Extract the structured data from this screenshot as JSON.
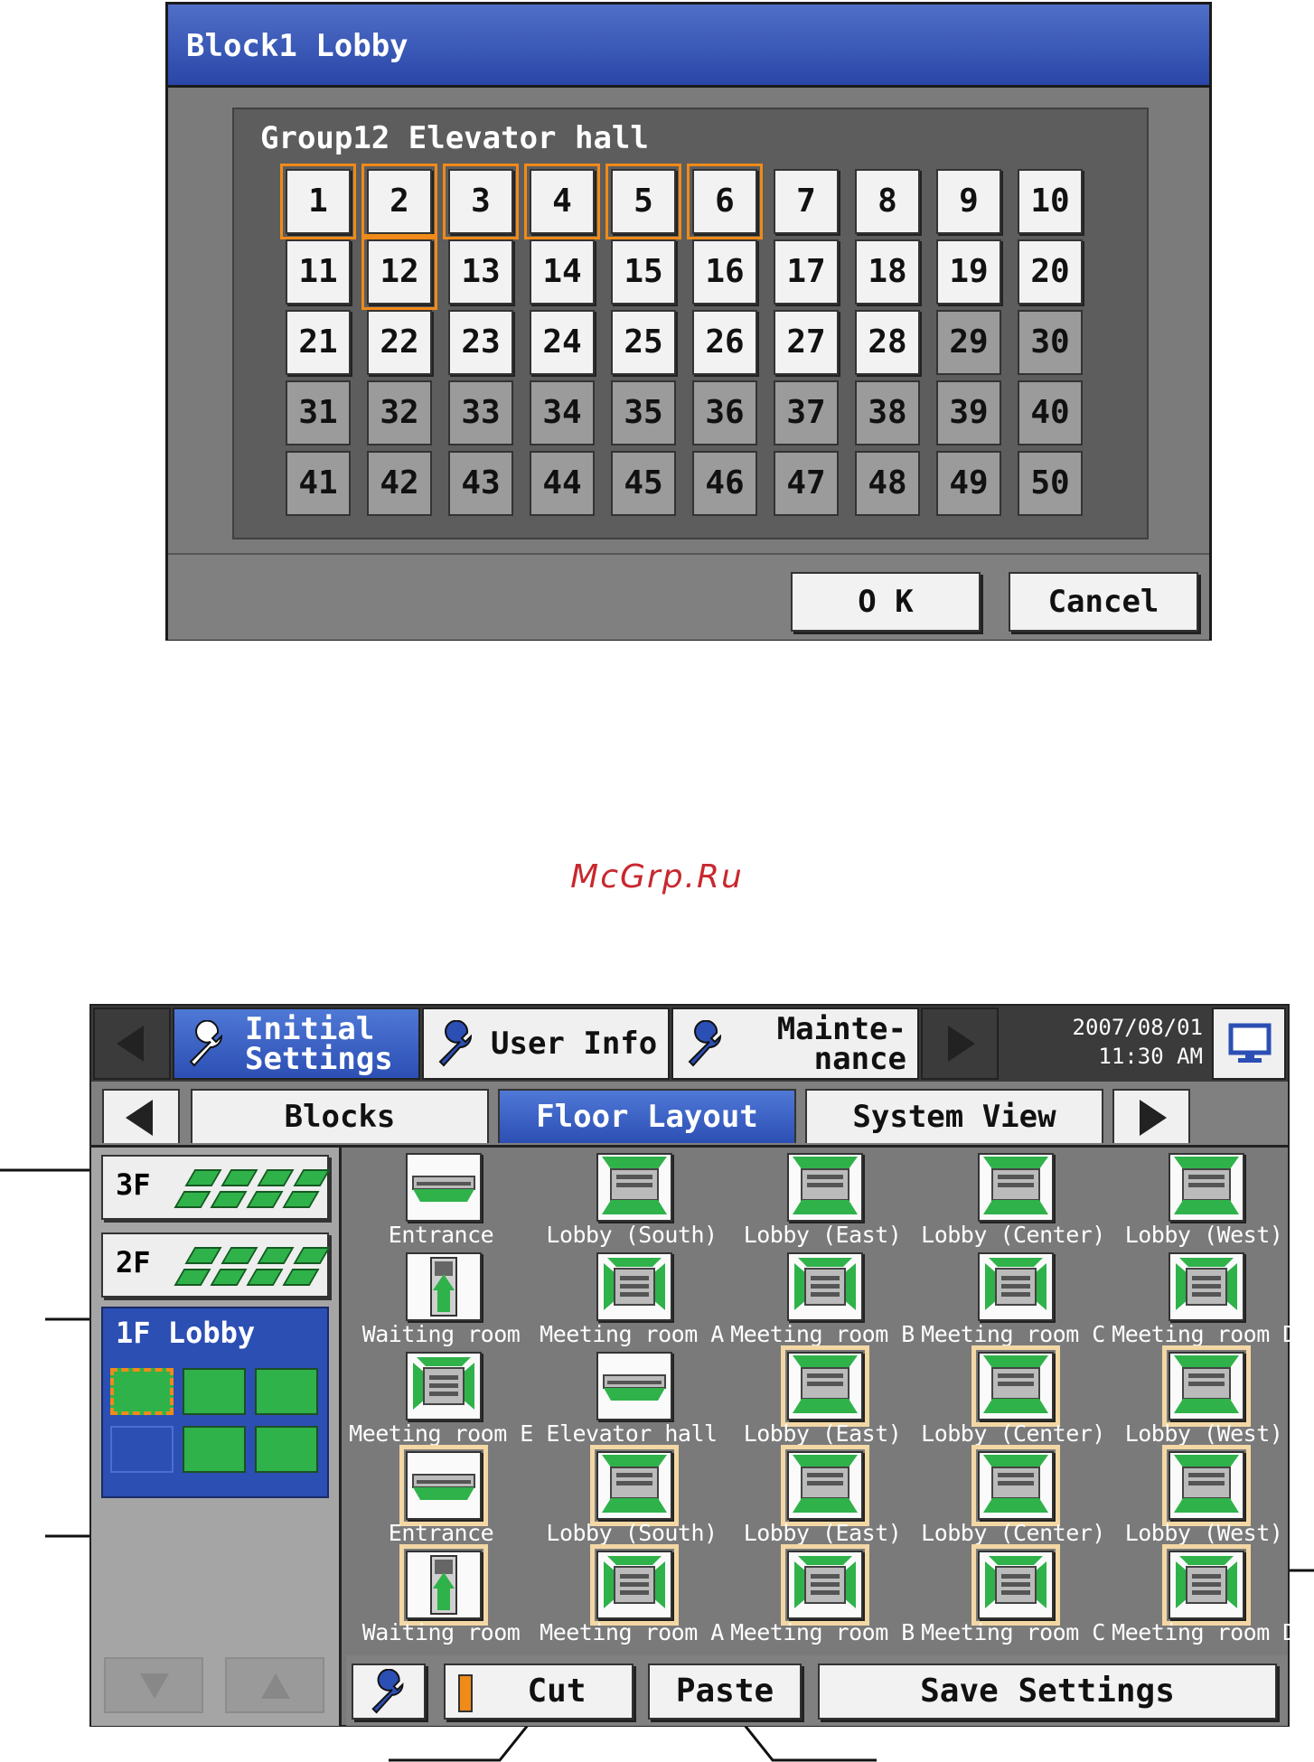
{
  "dialog": {
    "title": "Block1 Lobby",
    "group_label": "Group12 Elevator hall",
    "numbers": [
      "1",
      "2",
      "3",
      "4",
      "5",
      "6",
      "7",
      "8",
      "9",
      "10",
      "11",
      "12",
      "13",
      "14",
      "15",
      "16",
      "17",
      "18",
      "19",
      "20",
      "21",
      "22",
      "23",
      "24",
      "25",
      "26",
      "27",
      "28",
      "29",
      "30",
      "31",
      "32",
      "33",
      "34",
      "35",
      "36",
      "37",
      "38",
      "39",
      "40",
      "41",
      "42",
      "43",
      "44",
      "45",
      "46",
      "47",
      "48",
      "49",
      "50"
    ],
    "selected_numbers": [
      "1",
      "2",
      "3",
      "4",
      "5",
      "6",
      "12"
    ],
    "registered_numbers_last": "28",
    "ok_label": "O K",
    "cancel_label": "Cancel"
  },
  "watermark": "McGrp.Ru",
  "screen": {
    "tabs": [
      {
        "label": "Initial\nSettings",
        "active": true
      },
      {
        "label": "User Info",
        "active": false
      },
      {
        "label": "Mainte-\nnance",
        "active": false
      }
    ],
    "date": "2007/08/01",
    "time": "11:30 AM",
    "subtabs": [
      "Blocks",
      "Floor Layout",
      "System View"
    ],
    "active_subtab": "Floor Layout",
    "floors": [
      {
        "label": "3F"
      },
      {
        "label": "2F"
      },
      {
        "label": "1F Lobby",
        "active": true
      }
    ],
    "units": [
      {
        "label": "Entrance",
        "type": "ceiling",
        "selected": false
      },
      {
        "label": "Lobby (South)",
        "type": "ceiling-green",
        "selected": false
      },
      {
        "label": "Lobby (East)",
        "type": "ceiling-green",
        "selected": false
      },
      {
        "label": "Lobby (Center)",
        "type": "ceiling-green",
        "selected": false
      },
      {
        "label": "Lobby (West)",
        "type": "ceiling-green",
        "selected": false
      },
      {
        "label": "Waiting room",
        "type": "floor",
        "selected": false
      },
      {
        "label": "Meeting room A",
        "type": "cassette",
        "selected": false
      },
      {
        "label": "Meeting room B",
        "type": "cassette",
        "selected": false
      },
      {
        "label": "Meeting room C",
        "type": "cassette",
        "selected": false
      },
      {
        "label": "Meeting room D",
        "type": "cassette",
        "selected": false
      },
      {
        "label": "Meeting room E",
        "type": "cassette",
        "selected": false
      },
      {
        "label": "Elevator hall",
        "type": "ceiling",
        "selected": false
      },
      {
        "label": "Lobby (East)",
        "type": "ceiling-green",
        "selected": true
      },
      {
        "label": "Lobby (Center)",
        "type": "ceiling-green",
        "selected": true
      },
      {
        "label": "Lobby (West)",
        "type": "ceiling-green",
        "selected": true
      },
      {
        "label": "Entrance",
        "type": "ceiling",
        "selected": true
      },
      {
        "label": "Lobby (South)",
        "type": "ceiling-green",
        "selected": true
      },
      {
        "label": "Lobby (East)",
        "type": "ceiling-green",
        "selected": true
      },
      {
        "label": "Lobby (Center)",
        "type": "ceiling-green",
        "selected": true
      },
      {
        "label": "Lobby (West)",
        "type": "ceiling-green",
        "selected": true
      },
      {
        "label": "Waiting room",
        "type": "floor",
        "selected": true
      },
      {
        "label": "Meeting room A",
        "type": "cassette",
        "selected": true
      },
      {
        "label": "Meeting room B",
        "type": "cassette",
        "selected": true
      },
      {
        "label": "Meeting room C",
        "type": "cassette",
        "selected": true
      },
      {
        "label": "Meeting room D",
        "type": "cassette",
        "selected": true
      }
    ],
    "cut_label": "Cut",
    "paste_label": "Paste",
    "save_label": "Save Settings"
  },
  "colors": {
    "title_blue": "#2c4fb4",
    "select_orange": "#f08a18",
    "unit_green": "#2fb24a",
    "watermark_red": "#c8282e"
  }
}
